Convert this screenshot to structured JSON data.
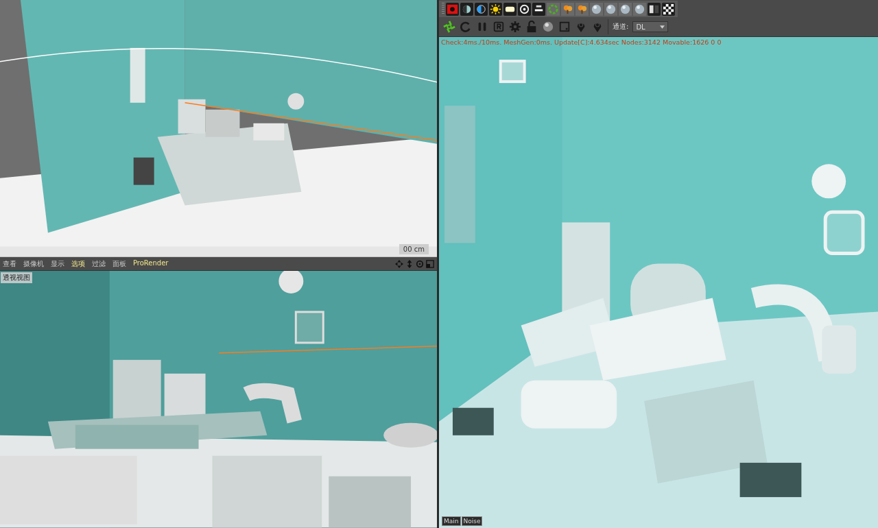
{
  "top_viewport": {
    "grid_readout": "00 cm"
  },
  "viewport_menu": [
    {
      "label": "查看",
      "highlighted": false
    },
    {
      "label": "摄像机",
      "highlighted": false
    },
    {
      "label": "显示",
      "highlighted": false
    },
    {
      "label": "选项",
      "highlighted": true
    },
    {
      "label": "过滤",
      "highlighted": false
    },
    {
      "label": "面板",
      "highlighted": false
    },
    {
      "label": "ProRender",
      "highlighted": true
    }
  ],
  "bottom_viewport": {
    "title": "透视视图"
  },
  "render_toolbar": {
    "channel_label": "通道:",
    "channel_value": "DL"
  },
  "render_status": "Check:4ms./10ms. MeshGen:0ms. Update[C]:4.634sec Nodes:3142 Movable:1626  0 0",
  "render_tabs": [
    {
      "label": "Main"
    },
    {
      "label": "Noise"
    }
  ]
}
